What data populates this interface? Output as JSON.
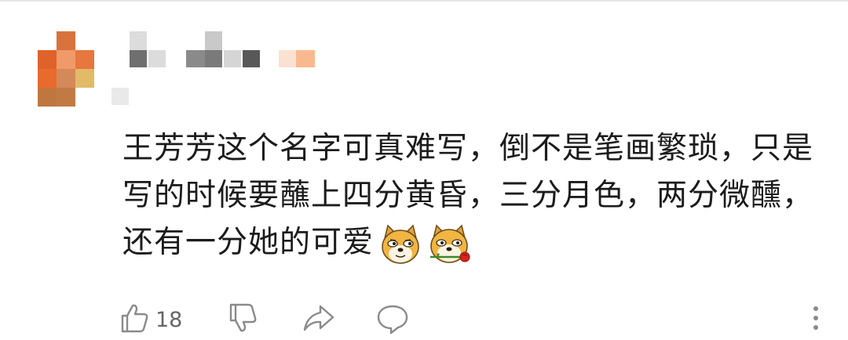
{
  "comment": {
    "lines": [
      "王芳芳这个名字可真难写，倒不是笔画繁琐，只是",
      "写的时候要蘸上四分黄昏，三分月色，两分微醺，",
      "还有一分她的可爱"
    ],
    "emojis": [
      "doge-face-emoji",
      "doge-rose-emoji"
    ]
  },
  "actions": {
    "like_count": "18",
    "icons": [
      "thumbs-up-icon",
      "thumbs-down-icon",
      "share-icon",
      "reply-icon",
      "more-icon"
    ]
  },
  "colors": {
    "text": "#1c1c1c",
    "icon": "#8a8a8a",
    "count": "#666666",
    "avatar_primary": "#e0622b",
    "background": "#ffffff"
  }
}
